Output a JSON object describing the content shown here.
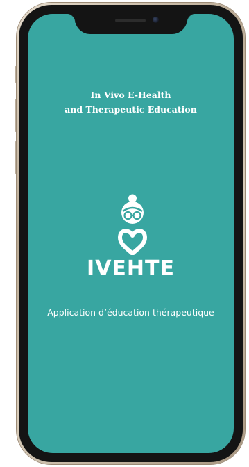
{
  "app": {
    "tagline_line1": "In Vivo E-Health",
    "tagline_line2": "and Therapeutic Education",
    "brand_name": "IVEHTE",
    "subtitle": "Application d’éducation thérapeutique"
  },
  "icons": {
    "logo": "caregiver-heart-icon",
    "camera": "front-camera-icon",
    "speaker": "earpiece-speaker-icon"
  },
  "colors": {
    "screen_background": "#38a6a1",
    "text": "#ffffff",
    "bezel": "#141414",
    "frame": "#c9bba8"
  }
}
